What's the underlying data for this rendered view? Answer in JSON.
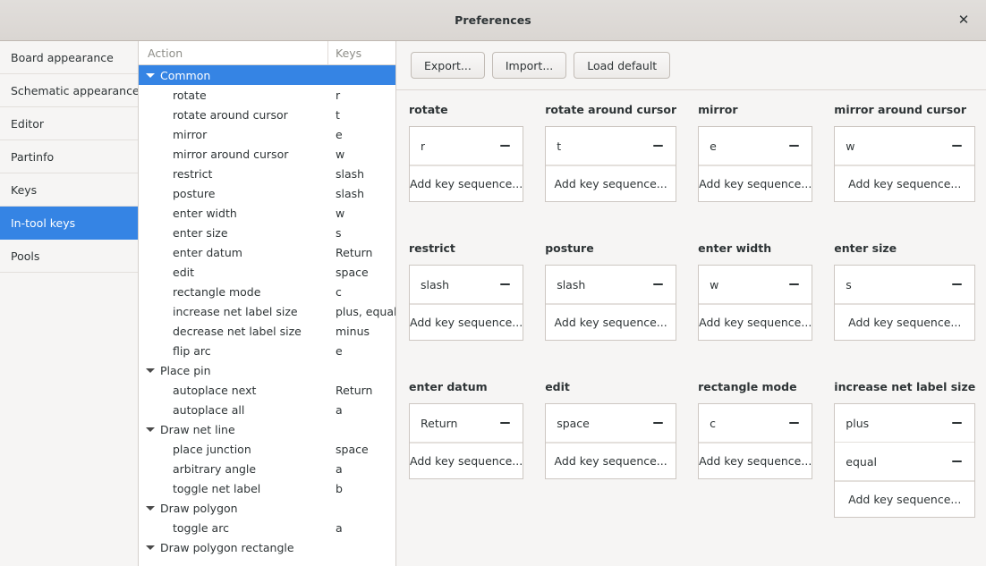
{
  "window": {
    "title": "Preferences",
    "close_icon": "close-icon",
    "close_glyph": "✕",
    "accent_color": "#3584e4",
    "background_color": "#f6f5f4",
    "titlebar_color": "#dad6d2"
  },
  "sidebar": {
    "items": [
      {
        "label": "Board appearance",
        "selected": false
      },
      {
        "label": "Schematic appearance",
        "selected": false
      },
      {
        "label": "Editor",
        "selected": false
      },
      {
        "label": "Partinfo",
        "selected": false
      },
      {
        "label": "Keys",
        "selected": false
      },
      {
        "label": "In-tool keys",
        "selected": true
      },
      {
        "label": "Pools",
        "selected": false
      }
    ]
  },
  "tree": {
    "columns": {
      "action": "Action",
      "keys": "Keys"
    },
    "rows": [
      {
        "type": "group",
        "label": "Common",
        "keys": "",
        "selected": true,
        "expanded": true
      },
      {
        "type": "child",
        "label": "rotate",
        "keys": "r"
      },
      {
        "type": "child",
        "label": "rotate around cursor",
        "keys": "t"
      },
      {
        "type": "child",
        "label": "mirror",
        "keys": "e"
      },
      {
        "type": "child",
        "label": "mirror around cursor",
        "keys": "w"
      },
      {
        "type": "child",
        "label": "restrict",
        "keys": "slash"
      },
      {
        "type": "child",
        "label": "posture",
        "keys": "slash"
      },
      {
        "type": "child",
        "label": "enter width",
        "keys": "w"
      },
      {
        "type": "child",
        "label": "enter size",
        "keys": "s"
      },
      {
        "type": "child",
        "label": "enter datum",
        "keys": "Return"
      },
      {
        "type": "child",
        "label": "edit",
        "keys": "space"
      },
      {
        "type": "child",
        "label": "rectangle mode",
        "keys": "c"
      },
      {
        "type": "child",
        "label": "increase net label size",
        "keys": "plus, equal"
      },
      {
        "type": "child",
        "label": "decrease net label size",
        "keys": "minus"
      },
      {
        "type": "child",
        "label": "flip arc",
        "keys": "e"
      },
      {
        "type": "group",
        "label": "Place pin",
        "keys": "",
        "selected": false,
        "expanded": true
      },
      {
        "type": "child",
        "label": "autoplace next",
        "keys": "Return"
      },
      {
        "type": "child",
        "label": "autoplace all",
        "keys": "a"
      },
      {
        "type": "group",
        "label": "Draw net line",
        "keys": "",
        "selected": false,
        "expanded": true
      },
      {
        "type": "child",
        "label": "place junction",
        "keys": "space"
      },
      {
        "type": "child",
        "label": "arbitrary angle",
        "keys": "a"
      },
      {
        "type": "child",
        "label": "toggle net label",
        "keys": "b"
      },
      {
        "type": "group",
        "label": "Draw polygon",
        "keys": "",
        "selected": false,
        "expanded": true
      },
      {
        "type": "child",
        "label": "toggle arc",
        "keys": "a"
      },
      {
        "type": "group",
        "label": "Draw polygon rectangle",
        "keys": "",
        "selected": false,
        "expanded": true
      }
    ]
  },
  "toolbar": {
    "export_label": "Export...",
    "import_label": "Import...",
    "load_default_label": "Load default"
  },
  "cards": {
    "add_label": "Add key sequence...",
    "items": [
      {
        "title": "rotate",
        "keys": [
          "r"
        ],
        "add": true
      },
      {
        "title": "rotate around cursor",
        "keys": [
          "t"
        ],
        "add": true
      },
      {
        "title": "mirror",
        "keys": [
          "e"
        ],
        "add": true
      },
      {
        "title": "mirror around cursor",
        "keys": [
          "w"
        ],
        "add": true
      },
      {
        "title": "restrict",
        "keys": [
          "slash"
        ],
        "add": true
      },
      {
        "title": "posture",
        "keys": [
          "slash"
        ],
        "add": true
      },
      {
        "title": "enter width",
        "keys": [
          "w"
        ],
        "add": true
      },
      {
        "title": "enter size",
        "keys": [
          "s"
        ],
        "add": true
      },
      {
        "title": "enter datum",
        "keys": [
          "Return"
        ],
        "add": true
      },
      {
        "title": "edit",
        "keys": [
          "space"
        ],
        "add": true
      },
      {
        "title": "rectangle mode",
        "keys": [
          "c"
        ],
        "add": true
      },
      {
        "title": "increase net label size",
        "keys": [
          "plus",
          "equal"
        ],
        "add": true
      }
    ]
  }
}
